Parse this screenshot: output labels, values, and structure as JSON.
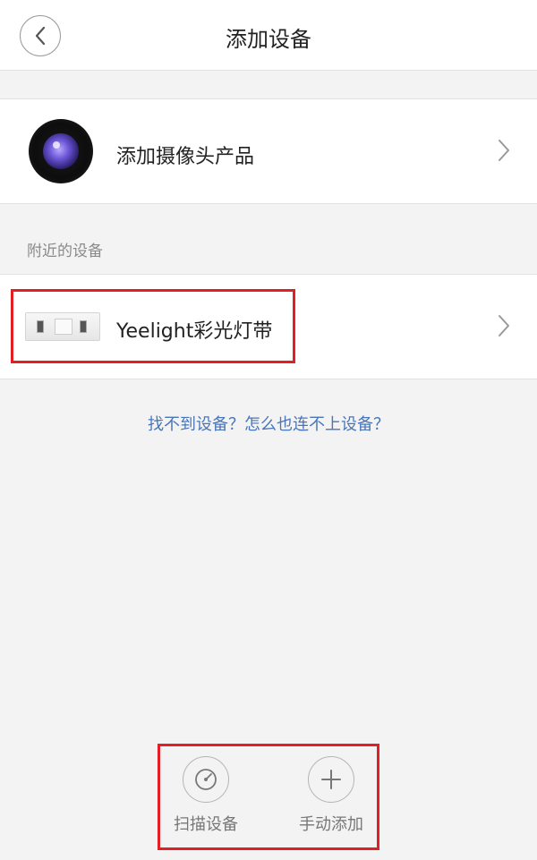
{
  "header": {
    "title": "添加设备",
    "back_icon": "chevron-left-icon"
  },
  "camera_entry": {
    "label": "添加摄像头产品",
    "icon": "camera-lens-icon",
    "arrow_icon": "chevron-right-icon"
  },
  "nearby": {
    "section_title": "附近的设备",
    "devices": [
      {
        "label": "Yeelight彩光灯带",
        "icon": "led-strip-icon",
        "arrow_icon": "chevron-right-icon"
      }
    ]
  },
  "help": {
    "link_text": "找不到设备？怎么也连不上设备？"
  },
  "bottom_actions": [
    {
      "label": "扫描设备",
      "icon": "scan-gauge-icon"
    },
    {
      "label": "手动添加",
      "icon": "plus-icon"
    }
  ],
  "colors": {
    "accent_link": "#4a76b8",
    "highlight_box": "#e31f25",
    "background": "#f3f3f3"
  }
}
